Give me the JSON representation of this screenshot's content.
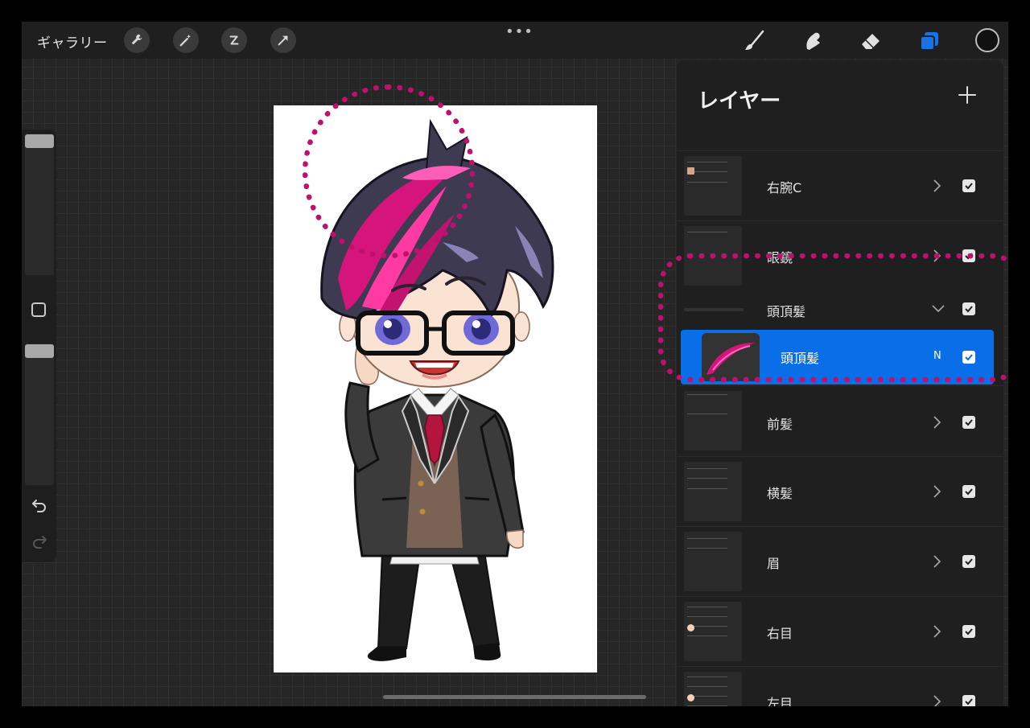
{
  "toolbar": {
    "gallery_label": "ギャラリー",
    "left_tools": [
      "wrench-icon",
      "magic-wand-icon",
      "selection-icon",
      "transform-arrow-icon"
    ],
    "more_label": "•••",
    "right_tools": [
      "brush-icon",
      "smudge-icon",
      "eraser-icon",
      "layers-icon",
      "color-icon"
    ],
    "accent": "#1773e6"
  },
  "layers_panel": {
    "title": "レイヤー",
    "add_label": "+",
    "layers": [
      {
        "name": "右腕C",
        "visible": true
      },
      {
        "name": "眼鏡",
        "visible": true
      },
      {
        "name": "頭頂髪",
        "visible": true,
        "is_group": true,
        "expanded": true
      },
      {
        "name": "頭頂髪",
        "visible": true,
        "selected": true,
        "blend_mode": "N"
      },
      {
        "name": "前髪",
        "visible": true
      },
      {
        "name": "横髪",
        "visible": true
      },
      {
        "name": "眉",
        "visible": true
      },
      {
        "name": "右目",
        "visible": true
      },
      {
        "name": "左目",
        "visible": true
      }
    ]
  },
  "colors": {
    "highlight": "#0a6ee8",
    "annotation": "#c0106e",
    "hair_magenta": "#d6157c"
  }
}
